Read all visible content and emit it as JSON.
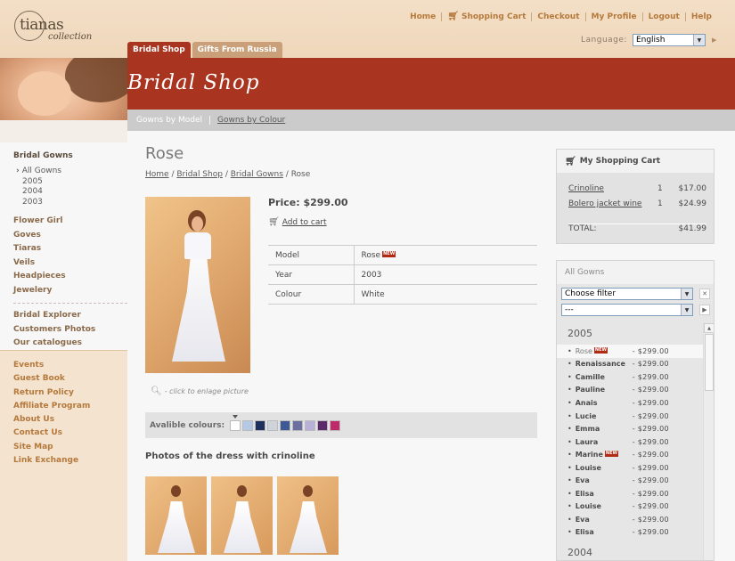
{
  "logo": {
    "word": "tianas",
    "sub": "collection"
  },
  "topnav": [
    "Home",
    "Shopping Cart",
    "Checkout",
    "My Profile",
    "Logout",
    "Help"
  ],
  "language": {
    "label": "Language:",
    "value": "English"
  },
  "tabs": [
    "Bridal Shop",
    "Gifts From Russia"
  ],
  "banner": {
    "title": "Bridal Shop"
  },
  "subnav": {
    "gowns_by_model": "Gowns by Model",
    "gowns_by_colour": "Gowns by Colour"
  },
  "sidebar": {
    "heading": "Bridal Gowns",
    "subitems": [
      "All Gowns",
      "2005",
      "2004",
      "2003"
    ],
    "items": [
      "Flower Girl",
      "Goves",
      "Tiaras",
      "Veils",
      "Headpieces",
      "Jewelery"
    ],
    "items2": [
      "Bridal Explorer",
      "Customers Photos",
      "Our catalogues"
    ],
    "lower": [
      "Events",
      "Guest Book",
      "Return Policy",
      "Affiliate Program",
      "About Us",
      "Contact Us",
      "Site Map",
      "Link Exchange"
    ]
  },
  "product": {
    "title": "Rose",
    "breadcrumb": [
      "Home",
      "Bridal Shop",
      "Bridal Gowns",
      "Rose"
    ],
    "price": "Price: $299.00",
    "add_to_cart": "Add to cart",
    "enlarge": "- click to enlage picture",
    "specs": [
      {
        "key": "Model",
        "value": "Rose",
        "new": "NEW"
      },
      {
        "key": "Year",
        "value": "2003"
      },
      {
        "key": "Colour",
        "value": "White"
      }
    ],
    "colours_label": "Avalible colours:",
    "colours": [
      "#ffffff",
      "#b5c8e6",
      "#1f2f5e",
      "#cfd3dc",
      "#3e5a96",
      "#6b6fa0",
      "#b8b0d8",
      "#5c2a6a",
      "#c02a6a"
    ],
    "crinoline_title": "Photos of the dress with crinoline"
  },
  "cart": {
    "title": "My Shopping Cart",
    "items": [
      {
        "name": "Crinoline",
        "qty": "1",
        "price": "$17.00"
      },
      {
        "name": "Bolero jacket wine",
        "qty": "1",
        "price": "$24.99"
      }
    ],
    "total_label": "TOTAL:",
    "total": "$41.99"
  },
  "gowns": {
    "title": "All Gowns",
    "filter1": "Choose filter",
    "filter2": "---",
    "year_2005": "2005",
    "year_2004": "2004",
    "list": [
      {
        "name": "Rose",
        "price": "- $299.00",
        "new": true
      },
      {
        "name": "Renaissance",
        "price": "- $299.00"
      },
      {
        "name": "Camille",
        "price": "- $299.00"
      },
      {
        "name": "Pauline",
        "price": "- $299.00"
      },
      {
        "name": "Anais",
        "price": "- $299.00"
      },
      {
        "name": "Lucie",
        "price": "- $299.00"
      },
      {
        "name": "Emma",
        "price": "- $299.00"
      },
      {
        "name": "Laura",
        "price": "- $299.00"
      },
      {
        "name": "Marine",
        "price": "- $299.00",
        "new": true
      },
      {
        "name": "Louise",
        "price": "- $299.00"
      },
      {
        "name": "Eva",
        "price": "- $299.00"
      },
      {
        "name": "Elisa",
        "price": "- $299.00"
      },
      {
        "name": "Louise",
        "price": "- $299.00"
      },
      {
        "name": "Eva",
        "price": "- $299.00"
      },
      {
        "name": "Elisa",
        "price": "- $299.00"
      }
    ],
    "new_badge": "NEW"
  },
  "icons": {
    "cart": "shopping-cart-icon",
    "magnifier": "magnifier-icon",
    "go": "arrow-right-icon",
    "close": "close-icon"
  }
}
